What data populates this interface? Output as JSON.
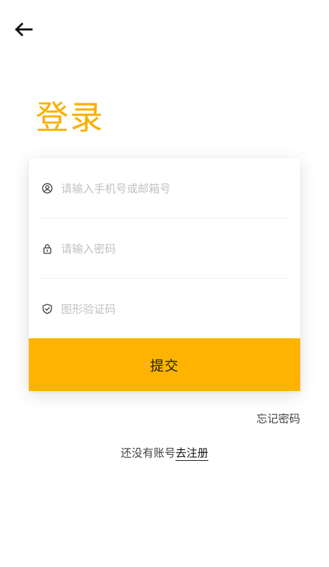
{
  "header": {
    "back_icon": "arrow-left-icon"
  },
  "page": {
    "title": "登录"
  },
  "form": {
    "account": {
      "icon": "user-circle-icon",
      "placeholder": "请输入手机号或邮箱号",
      "value": ""
    },
    "password": {
      "icon": "lock-icon",
      "placeholder": "请输入密码",
      "value": ""
    },
    "captcha": {
      "icon": "shield-check-icon",
      "placeholder": "图形验证码",
      "value": ""
    },
    "submit_label": "提交"
  },
  "links": {
    "forgot_password": "忘记密码",
    "no_account_text": "还没有账号",
    "register": "去注册"
  },
  "colors": {
    "accent": "#fdb300",
    "title": "#fbb000"
  }
}
